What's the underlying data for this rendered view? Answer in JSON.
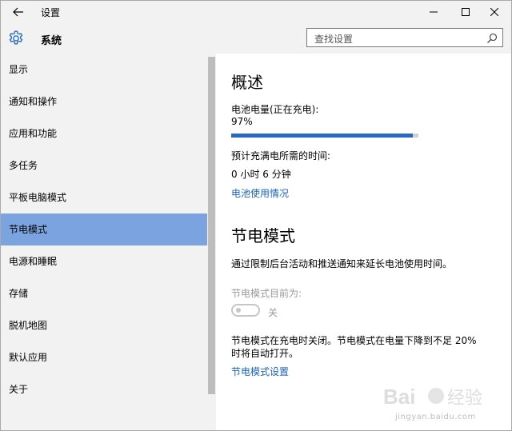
{
  "titlebar": {
    "title": "设置"
  },
  "header": {
    "title": "系统",
    "search_placeholder": "查找设置"
  },
  "sidebar": {
    "items": [
      {
        "label": "显示"
      },
      {
        "label": "通知和操作"
      },
      {
        "label": "应用和功能"
      },
      {
        "label": "多任务"
      },
      {
        "label": "平板电脑模式"
      },
      {
        "label": "节电模式",
        "selected": true
      },
      {
        "label": "电源和睡眠"
      },
      {
        "label": "存储"
      },
      {
        "label": "脱机地图"
      },
      {
        "label": "默认应用"
      },
      {
        "label": "关于"
      }
    ]
  },
  "overview": {
    "heading": "概述",
    "battery_label": "电池电量(正在充电):",
    "battery_value": "97%",
    "battery_fraction": 0.97,
    "time_label": "预计充满电所需的时间:",
    "time_value": "0 小时 6 分钟",
    "usage_link": "电池使用情况"
  },
  "battery_saver": {
    "heading": "节电模式",
    "description": "通过限制后台活动和推送通知来延长电池使用时间。",
    "status_label": "节电模式目前为:",
    "toggle_state": "关",
    "note_line1": "节电模式在充电时关闭。节电模式在电量下降到不足 20%",
    "note_line2": "时将自动打开。",
    "settings_link": "节电模式设置"
  },
  "watermark": {
    "url": "jingyan.baidu.com"
  },
  "colors": {
    "accent": "#7aa3df",
    "link": "#1a64c2",
    "progress": "#2a66c4"
  }
}
